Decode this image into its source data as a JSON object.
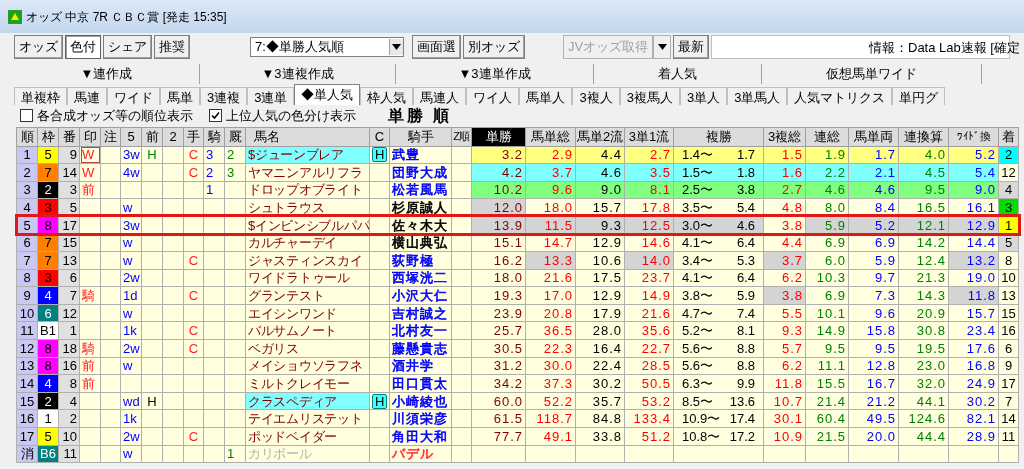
{
  "window": {
    "title": "オッズ 中京 7R ＣＢＣ賞 [発走 15:35]"
  },
  "toolbar": [
    {
      "kind": "button",
      "label": "オッズ",
      "pressed": false,
      "disabled": false
    },
    {
      "kind": "button",
      "label": "色付",
      "pressed": true,
      "disabled": false
    },
    {
      "kind": "button",
      "label": "シェア",
      "pressed": false,
      "disabled": false
    },
    {
      "kind": "button",
      "label": "推奨",
      "pressed": false,
      "disabled": false
    },
    {
      "kind": "select",
      "label": "7:◆単勝人気順"
    },
    {
      "kind": "button",
      "label": "画面選",
      "pressed": false,
      "disabled": false
    },
    {
      "kind": "button",
      "label": "別オッズ",
      "pressed": false,
      "disabled": false
    },
    {
      "kind": "split",
      "label": "JVオッズ取得",
      "disabled": true
    },
    {
      "kind": "button",
      "label": "最新",
      "pressed": false,
      "disabled": false
    },
    {
      "kind": "field"
    },
    {
      "kind": "info",
      "label": "情報：Data Lab速報 [確定"
    }
  ],
  "tab_groups": [
    "▼連作成",
    "▼3連複作成",
    "▼3連単作成",
    "着人気",
    "仮想馬単ワイド"
  ],
  "tabs": [
    {
      "label": "単複枠",
      "selected": false
    },
    {
      "label": "馬連",
      "selected": false
    },
    {
      "label": "ワイド",
      "selected": false
    },
    {
      "label": "馬単",
      "selected": false
    },
    {
      "label": "3連複",
      "selected": false
    },
    {
      "label": "3連単",
      "selected": false
    },
    {
      "label": "◆単人気",
      "selected": true
    },
    {
      "label": "枠人気",
      "selected": false
    },
    {
      "label": "馬連人",
      "selected": false
    },
    {
      "label": "ワイ人",
      "selected": false
    },
    {
      "label": "馬単人",
      "selected": false
    },
    {
      "label": "3複人",
      "selected": false
    },
    {
      "label": "3複馬人",
      "selected": false
    },
    {
      "label": "3単人",
      "selected": false
    },
    {
      "label": "3単馬人",
      "selected": false
    },
    {
      "label": "人気マトリクス",
      "selected": false
    },
    {
      "label": "単円グ",
      "selected": false
    }
  ],
  "options": [
    {
      "label": "各合成オッズ等の順位表示",
      "checked": false
    },
    {
      "label": "上位人気の色分け表示",
      "checked": true
    }
  ],
  "table_title": "単勝 順",
  "columns": [
    {
      "label": "順",
      "sorted": false
    },
    {
      "label": "枠",
      "sorted": false
    },
    {
      "label": "番",
      "sorted": false
    },
    {
      "label": "印",
      "sorted": false
    },
    {
      "label": "注",
      "sorted": false
    },
    {
      "label": "5",
      "sorted": false
    },
    {
      "label": "前",
      "sorted": false
    },
    {
      "label": "2",
      "sorted": false
    },
    {
      "label": "手",
      "sorted": false
    },
    {
      "label": "騎",
      "sorted": false
    },
    {
      "label": "厩",
      "sorted": false
    },
    {
      "label": "馬名",
      "sorted": false
    },
    {
      "label": "C",
      "sorted": false
    },
    {
      "label": "騎手",
      "sorted": false
    },
    {
      "label": "Z順",
      "sorted": false
    },
    {
      "label": "単勝",
      "sorted": true
    },
    {
      "label": "馬単総",
      "sorted": false
    },
    {
      "label": "馬単2流",
      "sorted": false
    },
    {
      "label": "3単1流",
      "sorted": false
    },
    {
      "label": "複勝",
      "sorted": false
    },
    {
      "label": "3複総",
      "sorted": false
    },
    {
      "label": "連総",
      "sorted": false
    },
    {
      "label": "馬単両",
      "sorted": false
    },
    {
      "label": "連換算",
      "sorted": false
    },
    {
      "label": "ﾜｲﾄﾞ換",
      "sorted": false
    },
    {
      "label": "着",
      "sorted": false
    }
  ],
  "rows": [
    {
      "rank": "1",
      "frame": {
        "text": "5",
        "color": "#ffff00"
      },
      "num": "9",
      "mark": "W",
      "mark_boxed": true,
      "c5": "3w",
      "mae": {
        "text": "H",
        "color": "#008000"
      },
      "te": "C",
      "ki": "3",
      "kyu": "2",
      "horse": "$ジューンブレア",
      "horse_highlighted": true,
      "scratched": false,
      "c": "H",
      "jockey": {
        "text": "武豊",
        "color": "#0000ff"
      },
      "color": "#ffff80",
      "outlined": false,
      "odds": [
        {
          "text": "3.2",
          "shaded": false
        },
        {
          "text": "2.9",
          "shaded": false
        },
        {
          "text": "4.4",
          "shaded": false
        },
        {
          "text": "2.7",
          "shaded": false
        },
        {
          "low": "1.4〜",
          "high": "1.7",
          "shaded": false
        },
        {
          "text": "1.5",
          "shaded": false
        },
        {
          "text": "1.9",
          "shaded": false
        },
        {
          "text": "1.7",
          "shaded": false
        },
        {
          "text": "4.0",
          "shaded": false
        },
        {
          "text": "5.2",
          "shaded": false
        }
      ],
      "finish": {
        "text": "2",
        "color": "#00ffff"
      }
    },
    {
      "rank": "2",
      "frame": {
        "text": "7",
        "color": "#ff8000"
      },
      "num": "14",
      "mark": "W",
      "mark_boxed": false,
      "c5": "4w",
      "te": "C",
      "ki": "2",
      "kyu": "3",
      "horse": "ヤマニンアルリフラ",
      "horse_highlighted": false,
      "scratched": false,
      "jockey": {
        "text": "団野大成",
        "color": "#0000ff"
      },
      "color": "#80ffff",
      "outlined": false,
      "odds": [
        {
          "text": "4.2",
          "shaded": false
        },
        {
          "text": "3.7",
          "shaded": false
        },
        {
          "text": "4.6",
          "shaded": false
        },
        {
          "text": "3.5",
          "shaded": false
        },
        {
          "low": "1.5〜",
          "high": "1.8",
          "shaded": false
        },
        {
          "text": "1.6",
          "shaded": false
        },
        {
          "text": "2.2",
          "shaded": false
        },
        {
          "text": "2.1",
          "shaded": false
        },
        {
          "text": "4.5",
          "shaded": false
        },
        {
          "text": "5.4",
          "shaded": false
        }
      ],
      "finish": {
        "text": "12",
        "color": "#ffffe0"
      }
    },
    {
      "rank": "3",
      "frame": {
        "text": "2",
        "color": "#000000"
      },
      "num": "3",
      "mark": "前",
      "mark_boxed": false,
      "ki": "1",
      "horse": "ドロップオブライト",
      "horse_highlighted": false,
      "scratched": false,
      "jockey": {
        "text": "松若風馬",
        "color": "#0000ff"
      },
      "color": "#80ff80",
      "outlined": false,
      "odds": [
        {
          "text": "10.2",
          "shaded": false
        },
        {
          "text": "9.6",
          "shaded": false
        },
        {
          "text": "9.0",
          "shaded": false
        },
        {
          "text": "8.1",
          "shaded": false
        },
        {
          "low": "2.5〜",
          "high": "3.8",
          "shaded": false
        },
        {
          "text": "2.7",
          "shaded": false
        },
        {
          "text": "4.6",
          "shaded": false
        },
        {
          "text": "4.6",
          "shaded": false
        },
        {
          "text": "9.5",
          "shaded": false
        },
        {
          "text": "9.0",
          "shaded": false
        }
      ],
      "finish": {
        "text": "4",
        "color": "#d8d8d8"
      }
    },
    {
      "rank": "4",
      "frame": {
        "text": "3",
        "color": "#ff0000"
      },
      "num": "5",
      "mark_boxed": false,
      "c5": "w",
      "horse": "シュトラウス",
      "horse_highlighted": false,
      "scratched": false,
      "jockey": {
        "text": "杉原誠人",
        "color": "#000000"
      },
      "outlined": false,
      "odds": [
        {
          "text": "12.0",
          "shaded": true
        },
        {
          "text": "18.0",
          "shaded": false
        },
        {
          "text": "15.7",
          "shaded": false
        },
        {
          "text": "17.8",
          "shaded": false
        },
        {
          "low": "3.5〜",
          "high": "5.4",
          "shaded": false
        },
        {
          "text": "4.8",
          "shaded": false
        },
        {
          "text": "8.0",
          "shaded": false
        },
        {
          "text": "8.4",
          "shaded": false
        },
        {
          "text": "16.5",
          "shaded": false
        },
        {
          "text": "16.1",
          "shaded": false
        }
      ],
      "finish": {
        "text": "3",
        "color": "#00e000"
      }
    },
    {
      "rank": "5",
      "frame": {
        "text": "8",
        "color": "#ff00ff"
      },
      "num": "17",
      "mark_boxed": false,
      "c5": "3w",
      "horse": "$インビンシブルパパ",
      "horse_highlighted": false,
      "scratched": false,
      "jockey": {
        "text": "佐々木大",
        "color": "#000000"
      },
      "outlined": true,
      "odds": [
        {
          "text": "13.9",
          "shaded": true
        },
        {
          "text": "11.5",
          "shaded": true
        },
        {
          "text": "9.3",
          "shaded": true
        },
        {
          "text": "12.5",
          "shaded": true
        },
        {
          "low": "3.0〜",
          "high": "4.6",
          "shaded": true
        },
        {
          "text": "3.8",
          "shaded": false
        },
        {
          "text": "5.9",
          "shaded": true
        },
        {
          "text": "5.2",
          "shaded": true
        },
        {
          "text": "12.1",
          "shaded": true
        },
        {
          "text": "12.9",
          "shaded": true
        }
      ],
      "finish": {
        "text": "1",
        "color": "#ffff00"
      }
    },
    {
      "rank": "6",
      "frame": {
        "text": "7",
        "color": "#ff8000"
      },
      "num": "15",
      "mark_boxed": false,
      "c5": "w",
      "horse": "カルチャーデイ",
      "horse_highlighted": false,
      "scratched": false,
      "jockey": {
        "text": "横山典弘",
        "color": "#000000"
      },
      "outlined": false,
      "odds": [
        {
          "text": "15.1",
          "shaded": false
        },
        {
          "text": "14.7",
          "shaded": false
        },
        {
          "text": "12.9",
          "shaded": false
        },
        {
          "text": "14.6",
          "shaded": false
        },
        {
          "low": "4.1〜",
          "high": "6.4",
          "shaded": false
        },
        {
          "text": "4.4",
          "shaded": false
        },
        {
          "text": "6.9",
          "shaded": false
        },
        {
          "text": "6.9",
          "shaded": false
        },
        {
          "text": "14.2",
          "shaded": false
        },
        {
          "text": "14.4",
          "shaded": false
        }
      ],
      "finish": {
        "text": "5",
        "color": "#d8d8d8"
      }
    },
    {
      "rank": "7",
      "frame": {
        "text": "7",
        "color": "#ff8000"
      },
      "num": "13",
      "mark_boxed": false,
      "c5": "w",
      "te": "C",
      "horse": "ジャスティンスカイ",
      "horse_highlighted": false,
      "scratched": false,
      "jockey": {
        "text": "荻野極",
        "color": "#0000ff"
      },
      "outlined": false,
      "odds": [
        {
          "text": "16.2",
          "shaded": false
        },
        {
          "text": "13.3",
          "shaded": true
        },
        {
          "text": "10.6",
          "shaded": false
        },
        {
          "text": "14.0",
          "shaded": true
        },
        {
          "low": "3.4〜",
          "high": "5.3",
          "shaded": false
        },
        {
          "text": "3.7",
          "shaded": true
        },
        {
          "text": "6.0",
          "shaded": false
        },
        {
          "text": "5.9",
          "shaded": false
        },
        {
          "text": "12.4",
          "shaded": false
        },
        {
          "text": "13.2",
          "shaded": true
        }
      ],
      "finish": {
        "text": "8",
        "color": "#ffffe0"
      }
    },
    {
      "rank": "8",
      "frame": {
        "text": "3",
        "color": "#ff0000"
      },
      "num": "6",
      "mark_boxed": false,
      "c5": "2w",
      "horse": "ワイドラトゥール",
      "horse_highlighted": false,
      "scratched": false,
      "jockey": {
        "text": "西塚洸二",
        "color": "#0000ff"
      },
      "outlined": false,
      "odds": [
        {
          "text": "18.0",
          "shaded": false
        },
        {
          "text": "21.6",
          "shaded": false
        },
        {
          "text": "17.5",
          "shaded": false
        },
        {
          "text": "23.7",
          "shaded": false
        },
        {
          "low": "4.1〜",
          "high": "6.4",
          "shaded": false
        },
        {
          "text": "6.2",
          "shaded": false
        },
        {
          "text": "10.3",
          "shaded": false
        },
        {
          "text": "9.7",
          "shaded": false
        },
        {
          "text": "21.3",
          "shaded": false
        },
        {
          "text": "19.0",
          "shaded": false
        }
      ],
      "finish": {
        "text": "10",
        "color": "#ffffe0"
      }
    },
    {
      "rank": "9",
      "frame": {
        "text": "4",
        "color": "#0000ff"
      },
      "num": "7",
      "mark": "騎",
      "mark_boxed": false,
      "c5": "1d",
      "te": "C",
      "horse": "グランテスト",
      "horse_highlighted": false,
      "scratched": false,
      "jockey": {
        "text": "小沢大仁",
        "color": "#0000ff"
      },
      "outlined": false,
      "odds": [
        {
          "text": "19.3",
          "shaded": false
        },
        {
          "text": "17.0",
          "shaded": false
        },
        {
          "text": "12.9",
          "shaded": false
        },
        {
          "text": "14.9",
          "shaded": false
        },
        {
          "low": "3.8〜",
          "high": "5.9",
          "shaded": false
        },
        {
          "text": "3.8",
          "shaded": true
        },
        {
          "text": "6.9",
          "shaded": false
        },
        {
          "text": "7.3",
          "shaded": false
        },
        {
          "text": "14.3",
          "shaded": false
        },
        {
          "text": "11.8",
          "shaded": true
        }
      ],
      "finish": {
        "text": "13",
        "color": "#ffffe0"
      }
    },
    {
      "rank": "10",
      "frame": {
        "text": "6",
        "color": "#008080"
      },
      "num": "12",
      "mark_boxed": false,
      "c5": "w",
      "horse": "エイシンワンド",
      "horse_highlighted": false,
      "scratched": false,
      "jockey": {
        "text": "吉村誠之",
        "color": "#0000ff"
      },
      "outlined": false,
      "odds": [
        {
          "text": "23.9",
          "shaded": false
        },
        {
          "text": "20.8",
          "shaded": false
        },
        {
          "text": "17.9",
          "shaded": false
        },
        {
          "text": "21.6",
          "shaded": false
        },
        {
          "low": "4.7〜",
          "high": "7.4",
          "shaded": false
        },
        {
          "text": "5.5",
          "shaded": false
        },
        {
          "text": "10.1",
          "shaded": false
        },
        {
          "text": "9.6",
          "shaded": false
        },
        {
          "text": "20.9",
          "shaded": false
        },
        {
          "text": "15.7",
          "shaded": false
        }
      ],
      "finish": {
        "text": "15",
        "color": "#ffffe0"
      }
    },
    {
      "rank": "11",
      "frame": {
        "text": "B1",
        "color": "#ffffff"
      },
      "num": "1",
      "mark_boxed": false,
      "c5": "1k",
      "te": "C",
      "horse": "バルサムノート",
      "horse_highlighted": false,
      "scratched": false,
      "jockey": {
        "text": "北村友一",
        "color": "#0000ff"
      },
      "outlined": false,
      "odds": [
        {
          "text": "25.7",
          "shaded": false
        },
        {
          "text": "36.5",
          "shaded": false
        },
        {
          "text": "28.0",
          "shaded": false
        },
        {
          "text": "35.6",
          "shaded": false
        },
        {
          "low": "5.2〜",
          "high": "8.1",
          "shaded": false
        },
        {
          "text": "9.3",
          "shaded": false
        },
        {
          "text": "14.9",
          "shaded": false
        },
        {
          "text": "15.8",
          "shaded": false
        },
        {
          "text": "30.8",
          "shaded": false
        },
        {
          "text": "23.4",
          "shaded": false
        }
      ],
      "finish": {
        "text": "16",
        "color": "#ffffe0"
      }
    },
    {
      "rank": "12",
      "frame": {
        "text": "8",
        "color": "#ff00ff"
      },
      "num": "18",
      "mark": "騎",
      "mark_boxed": false,
      "c5": "2w",
      "te": "C",
      "horse": "ベガリス",
      "horse_highlighted": false,
      "scratched": false,
      "jockey": {
        "text": "藤懸貴志",
        "color": "#0000ff"
      },
      "outlined": false,
      "odds": [
        {
          "text": "30.5",
          "shaded": false
        },
        {
          "text": "22.3",
          "shaded": false
        },
        {
          "text": "16.4",
          "shaded": false
        },
        {
          "text": "22.7",
          "shaded": false
        },
        {
          "low": "5.6〜",
          "high": "8.8",
          "shaded": false
        },
        {
          "text": "5.7",
          "shaded": false
        },
        {
          "text": "9.5",
          "shaded": false
        },
        {
          "text": "9.5",
          "shaded": false
        },
        {
          "text": "19.5",
          "shaded": false
        },
        {
          "text": "17.6",
          "shaded": false
        }
      ],
      "finish": {
        "text": "6",
        "color": "#ffffe0"
      }
    },
    {
      "rank": "13",
      "frame": {
        "text": "8",
        "color": "#ff00ff"
      },
      "num": "16",
      "mark": "前",
      "mark_boxed": false,
      "c5": "w",
      "horse": "メイショウソラフネ",
      "horse_highlighted": false,
      "scratched": false,
      "jockey": {
        "text": "酒井学",
        "color": "#0000ff"
      },
      "outlined": false,
      "odds": [
        {
          "text": "31.2",
          "shaded": false
        },
        {
          "text": "30.0",
          "shaded": false
        },
        {
          "text": "22.4",
          "shaded": false
        },
        {
          "text": "28.5",
          "shaded": false
        },
        {
          "low": "5.6〜",
          "high": "8.8",
          "shaded": false
        },
        {
          "text": "6.2",
          "shaded": false
        },
        {
          "text": "11.1",
          "shaded": false
        },
        {
          "text": "12.8",
          "shaded": false
        },
        {
          "text": "23.0",
          "shaded": false
        },
        {
          "text": "16.8",
          "shaded": false
        }
      ],
      "finish": {
        "text": "9",
        "color": "#ffffe0"
      }
    },
    {
      "rank": "14",
      "frame": {
        "text": "4",
        "color": "#0000ff"
      },
      "num": "8",
      "mark": "前",
      "mark_boxed": false,
      "horse": "ミルトクレイモー",
      "horse_highlighted": false,
      "scratched": false,
      "jockey": {
        "text": "田口貫太",
        "color": "#0000ff"
      },
      "outlined": false,
      "odds": [
        {
          "text": "34.2",
          "shaded": false
        },
        {
          "text": "37.3",
          "shaded": false
        },
        {
          "text": "30.2",
          "shaded": false
        },
        {
          "text": "50.5",
          "shaded": false
        },
        {
          "low": "6.3〜",
          "high": "9.9",
          "shaded": false
        },
        {
          "text": "11.8",
          "shaded": false
        },
        {
          "text": "15.5",
          "shaded": false
        },
        {
          "text": "16.7",
          "shaded": false
        },
        {
          "text": "32.0",
          "shaded": false
        },
        {
          "text": "24.9",
          "shaded": false
        }
      ],
      "finish": {
        "text": "17",
        "color": "#ffffe0"
      }
    },
    {
      "rank": "15",
      "frame": {
        "text": "2",
        "color": "#000000"
      },
      "num": "4",
      "mark_boxed": false,
      "c5": "wd",
      "mae": {
        "text": "H",
        "color": "#000000"
      },
      "horse": "クラスペディア",
      "horse_highlighted": true,
      "scratched": false,
      "c": "H",
      "jockey": {
        "text": "小崎綾也",
        "color": "#0000ff"
      },
      "outlined": false,
      "odds": [
        {
          "text": "60.0",
          "shaded": false
        },
        {
          "text": "52.2",
          "shaded": false
        },
        {
          "text": "35.7",
          "shaded": false
        },
        {
          "text": "53.2",
          "shaded": false
        },
        {
          "low": "8.5〜",
          "high": "13.6",
          "shaded": false
        },
        {
          "text": "10.7",
          "shaded": false
        },
        {
          "text": "21.4",
          "shaded": false
        },
        {
          "text": "21.2",
          "shaded": false
        },
        {
          "text": "44.1",
          "shaded": false
        },
        {
          "text": "30.2",
          "shaded": false
        }
      ],
      "finish": {
        "text": "7",
        "color": "#ffffe0"
      }
    },
    {
      "rank": "16",
      "frame": {
        "text": "1",
        "color": "#ffffff"
      },
      "num": "2",
      "mark_boxed": false,
      "c5": "1k",
      "horse": "テイエムリステット",
      "horse_highlighted": false,
      "scratched": false,
      "jockey": {
        "text": "川須栄彦",
        "color": "#0000ff"
      },
      "outlined": false,
      "odds": [
        {
          "text": "61.5",
          "shaded": false
        },
        {
          "text": "118.7",
          "shaded": false
        },
        {
          "text": "84.8",
          "shaded": false
        },
        {
          "text": "133.4",
          "shaded": false
        },
        {
          "low": "10.9〜",
          "high": "17.4",
          "shaded": false
        },
        {
          "text": "30.1",
          "shaded": false
        },
        {
          "text": "60.4",
          "shaded": false
        },
        {
          "text": "49.5",
          "shaded": false
        },
        {
          "text": "124.6",
          "shaded": false
        },
        {
          "text": "82.1",
          "shaded": false
        }
      ],
      "finish": {
        "text": "14",
        "color": "#ffffe0"
      }
    },
    {
      "rank": "17",
      "frame": {
        "text": "5",
        "color": "#ffff00"
      },
      "num": "10",
      "mark_boxed": false,
      "c5": "2w",
      "te": "C",
      "horse": "ポッドベイダー",
      "horse_highlighted": false,
      "scratched": false,
      "jockey": {
        "text": "角田大和",
        "color": "#0000ff"
      },
      "outlined": false,
      "odds": [
        {
          "text": "77.7",
          "shaded": false
        },
        {
          "text": "49.1",
          "shaded": false
        },
        {
          "text": "33.8",
          "shaded": false
        },
        {
          "text": "51.2",
          "shaded": false
        },
        {
          "low": "10.8〜",
          "high": "17.2",
          "shaded": false
        },
        {
          "text": "10.9",
          "shaded": false
        },
        {
          "text": "21.5",
          "shaded": false
        },
        {
          "text": "20.0",
          "shaded": false
        },
        {
          "text": "44.4",
          "shaded": false
        },
        {
          "text": "28.9",
          "shaded": false
        }
      ],
      "finish": {
        "text": "11",
        "color": "#ffffe0"
      }
    },
    {
      "rank": "消",
      "frame": {
        "text": "B6",
        "color": "#008080"
      },
      "num": "11",
      "mark_boxed": false,
      "c5": "w",
      "kyu": "1",
      "horse": "カリボール",
      "horse_highlighted": false,
      "scratched": true,
      "jockey": {
        "text": "バデル",
        "color": "#ff3030"
      },
      "outlined": false
    }
  ]
}
